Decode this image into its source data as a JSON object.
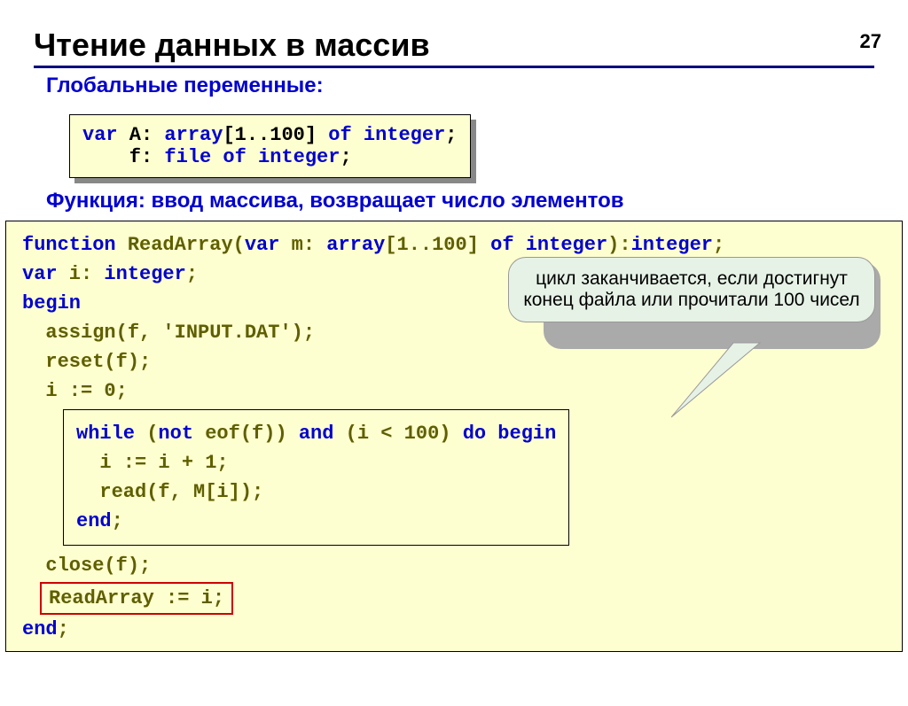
{
  "page_number": "27",
  "title": "Чтение данных в массив",
  "subtitle1": "Глобальные переменные:",
  "box1_line1a": "var",
  "box1_line1b": " A: ",
  "box1_line1c": "array",
  "box1_line1d": "[1..100] ",
  "box1_line1e": "of integer",
  "box1_line1f": ";",
  "box1_line2a": "    f: ",
  "box1_line2b": "file of integer",
  "box1_line2c": ";",
  "subtitle2": "Функция: ввод массива, возвращает число элементов",
  "fn_line1a": "function",
  "fn_line1b": " ReadArray(",
  "fn_line1c": "var",
  "fn_line1d": " m: ",
  "fn_line1e": "array",
  "fn_line1f": "[1..100] ",
  "fn_line1g": "of integer",
  "fn_line1h": "):",
  "fn_line1i": "integer",
  "fn_line1j": ";",
  "fn_line2a": "var",
  "fn_line2b": " i: ",
  "fn_line2c": "integer",
  "fn_line2d": ";",
  "fn_line3a": "begin",
  "fn_line4": "  assign(f, 'INPUT.DAT');",
  "fn_line5": "  reset(f);",
  "fn_line6": "  i := 0;",
  "wh_line1a": "while",
  "wh_line1b": " (",
  "wh_line1c": "not",
  "wh_line1d": " eof(f)) ",
  "wh_line1e": "and",
  "wh_line1f": " (i < 100) ",
  "wh_line1g": "do begin",
  "wh_line2": "  i := i + 1;",
  "wh_line3": "  read(f, M[i]);",
  "wh_line4a": "end",
  "wh_line4b": ";",
  "fn_line7": "  close(f);",
  "red_text": "ReadArray := i;",
  "fn_end_a": "end",
  "fn_end_b": ";",
  "callout": "цикл заканчивается, если достигнут конец файла или прочитали 100 чисел"
}
